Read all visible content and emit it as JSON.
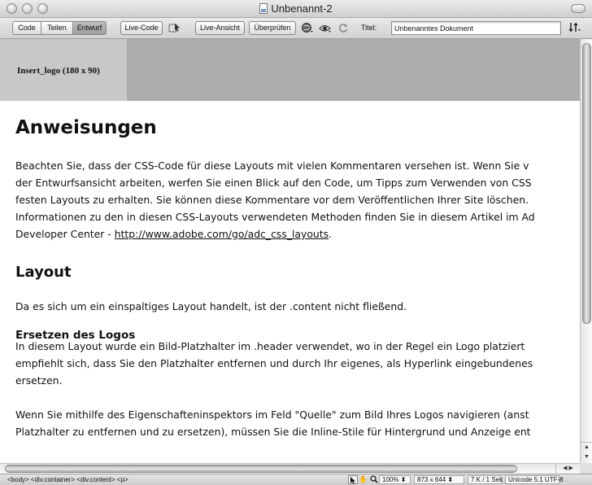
{
  "window": {
    "title": "Unbenannt-2"
  },
  "toolbar": {
    "view_code": "Code",
    "view_split": "Teilen",
    "view_design": "Entwurf",
    "live_code": "Live-Code",
    "live_view": "Live-Ansicht",
    "check": "Überprüfen",
    "title_label": "Titel:",
    "title_value": "Unbenanntes Dokument"
  },
  "header": {
    "logo_placeholder": "Insert_logo (180 x 90)"
  },
  "content": {
    "h1": "Anweisungen",
    "p1_lines": [
      "Beachten Sie, dass der CSS-Code für diese Layouts mit vielen Kommentaren versehen ist. Wenn Sie v",
      "der Entwurfsansicht arbeiten, werfen Sie einen Blick auf den Code, um Tipps zum Verwenden von CSS",
      "festen Layouts zu erhalten. Sie können diese Kommentare vor dem Veröffentlichen Ihrer Site löschen.",
      "Informationen zu den in diesen CSS-Layouts verwendeten Methoden finden Sie in diesem Artikel im Ad"
    ],
    "p1_last_prefix": "Developer Center - ",
    "p1_link": "http://www.adobe.com/go/adc_css_layouts",
    "p1_last_suffix": ".",
    "h2_layout": "Layout",
    "p2": "Da es sich um ein einspaltiges Layout handelt, ist der .content nicht fließend.",
    "h3_logo": "Ersetzen des Logos",
    "p3_lines": [
      "In diesem Layout wurde ein Bild-Platzhalter im .header verwendet, wo in der Regel ein Logo platziert",
      "empfiehlt sich, dass Sie den Platzhalter entfernen und durch Ihr eigenes, als Hyperlink eingebundenes",
      "ersetzen."
    ],
    "p4_lines": [
      "Wenn Sie mithilfe des Eigenschafteninspektors im Feld \"Quelle\" zum Bild Ihres Logos navigieren (anst",
      "Platzhalter zu entfernen und zu ersetzen), müssen Sie die Inline-Stile für Hintergrund und Anzeige ent"
    ]
  },
  "statusbar": {
    "tag_selector": "<body> <div.container> <div.content> <p>",
    "zoom": "100%",
    "window_size": "873 x 644",
    "download": "7 K / 1 Sek",
    "encoding": "Unicode 5.1 UTF-8"
  }
}
